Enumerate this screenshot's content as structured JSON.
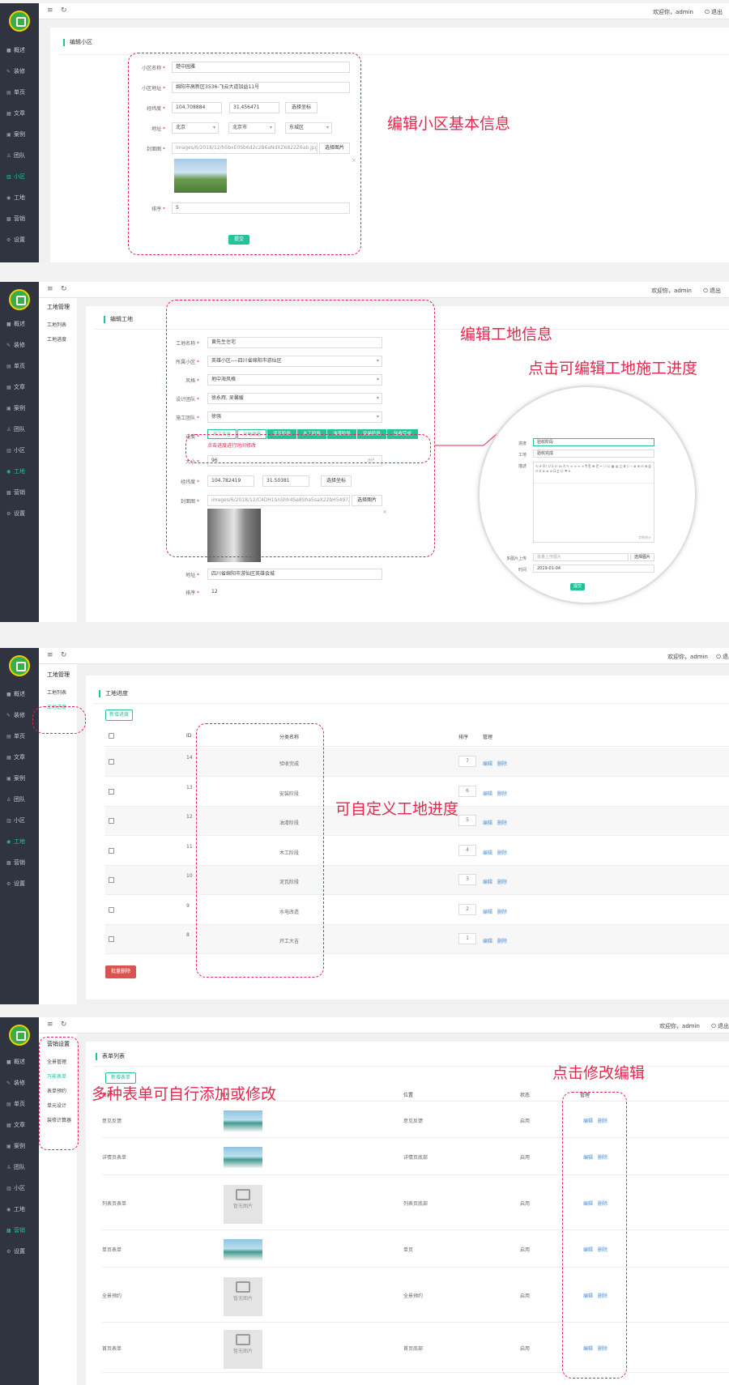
{
  "common": {
    "logo_text": "",
    "user_greeting": "欢迎你，admin",
    "logout_label": "退出",
    "menu_icon": "menu-icon",
    "refresh_icon": "refresh-icon",
    "nav": [
      {
        "label": "概述",
        "icon": "home-icon"
      },
      {
        "label": "装修",
        "icon": "brush-icon"
      },
      {
        "label": "单页",
        "icon": "page-icon"
      },
      {
        "label": "文章",
        "icon": "article-icon"
      },
      {
        "label": "案例",
        "icon": "case-icon"
      },
      {
        "label": "团队",
        "icon": "team-icon"
      },
      {
        "label": "小区",
        "icon": "building-icon"
      },
      {
        "label": "工地",
        "icon": "site-icon"
      },
      {
        "label": "营销",
        "icon": "marketing-icon"
      },
      {
        "label": "设置",
        "icon": "settings-icon"
      }
    ]
  },
  "panel1": {
    "nav_variant": [
      "概述",
      "装修",
      "单页",
      "文章",
      "案例",
      "团队",
      "小区",
      "工地",
      "营销",
      "设置"
    ],
    "title": "编辑小区",
    "fields": {
      "name_label": "小区名称",
      "name_value": "楚中园雅",
      "address_label": "小区地址",
      "address_value": "绵阳市高新区3536-飞云大道加益11号",
      "coord_label": "经纬度",
      "lng": "104.708884",
      "lat": "31.456471",
      "coord_btn": "选择坐标",
      "region_label": "地址",
      "province": "北京",
      "city": "北京市",
      "district": "东城区",
      "cover_label": "封面图",
      "cover_path": "images/6/2018/12/h5bxE0Sb6d2c2B6aNdXZ6822Z6ab.jpg",
      "cover_btn": "选择图片",
      "sort_label": "排序",
      "sort_value": "5",
      "submit": "提交"
    },
    "annotation": "编辑小区基本信息"
  },
  "panel2": {
    "subnav": [
      "工地管理",
      "工地列表",
      "工地进度"
    ],
    "title": "编辑工地",
    "fields": {
      "name_label": "工地名称",
      "name_value": "黄先生住宅",
      "community_label": "所属小区",
      "community_value": "英雄小区----四川省绵阳市游仙区",
      "style_label": "风格",
      "style_value": "地中海风格",
      "design_label": "设计团队",
      "design_value": "徐永辉, 吴馨媛",
      "build_label": "施工团队",
      "build_value": "徐强",
      "progress_label": "进度",
      "steps": [
        "开工大吉",
        "水电改造",
        "泥瓦阶段",
        "木工阶段",
        "油漆阶段",
        "安装阶段",
        "验收完成"
      ],
      "progress_hint": "点击进度进行时间修改",
      "size_label": "大小",
      "size_value": "96",
      "size_unit": "m²",
      "coord_label": "经纬度",
      "lng": "104.782419",
      "lat": "31.50381",
      "coord_btn": "选择坐标",
      "cover_label": "封面图",
      "cover_path": "images/6/2018/12/C4DH1SnShh4Sa8Sha5saX22bH54972.jpg",
      "cover_btn": "选择图片",
      "address_label": "地址",
      "address_value": "四川省绵阳市游仙区英雄会城",
      "sort_label": "排序",
      "sort_value": "12"
    },
    "annotation_top": "编辑工地信息",
    "annotation_progress": "点击可编辑工地施工进度",
    "zoom": {
      "stage_label": "进度",
      "stage_value": "验收阶段",
      "worksite_label": "工地",
      "worksite_value": "验收完成",
      "desc_label": "描述",
      "toolbar": "编辑器工具栏",
      "counter": "字数统计",
      "image_label": "多图片上传",
      "image_value": "批量上传图片",
      "image_btn": "选择图片",
      "time_label": "时间",
      "time_value": "2019-01-04",
      "submit": "提交"
    }
  },
  "panel3": {
    "subnav": [
      "工地管理",
      "工地列表",
      "工地进度"
    ],
    "title": "工地进度",
    "add_btn": "新增进度",
    "headers": {
      "id": "ID",
      "name": "分类名称",
      "sort": "排序",
      "manage": "管理"
    },
    "rows": [
      {
        "id": "14",
        "name": "验收完成",
        "sort": "7"
      },
      {
        "id": "13",
        "name": "安装阶段",
        "sort": "6"
      },
      {
        "id": "12",
        "name": "油漆阶段",
        "sort": "5"
      },
      {
        "id": "11",
        "name": "木工阶段",
        "sort": "4"
      },
      {
        "id": "10",
        "name": "泥瓦阶段",
        "sort": "3"
      },
      {
        "id": "9",
        "name": "水电改造",
        "sort": "2"
      },
      {
        "id": "8",
        "name": "开工大吉",
        "sort": "1"
      }
    ],
    "edit_label": "编辑",
    "delete_label": "删除",
    "batch_delete": "批量删除",
    "annotation": "可自定义工地进度"
  },
  "panel4": {
    "subnav": [
      "营销设置",
      "全景管理",
      "万能表单",
      "表单预约",
      "单元设计",
      "装修计算器"
    ],
    "title": "表单列表",
    "add_btn": "新增表单",
    "headers": {
      "name": "名称",
      "image": "图片",
      "position": "位置",
      "status": "状态",
      "manage": "管理"
    },
    "rows": [
      {
        "name": "意见反馈",
        "position": "意见反馈",
        "status": "启用",
        "img": "photo"
      },
      {
        "name": "详情页表单",
        "position": "详情页底部",
        "status": "启用",
        "img": "photo"
      },
      {
        "name": "列表页表单",
        "position": "列表页底部",
        "status": "启用",
        "img": "none"
      },
      {
        "name": "单页表单",
        "position": "单页",
        "status": "启用",
        "img": "photo"
      },
      {
        "name": "全景预约",
        "position": "全景预约",
        "status": "启用",
        "img": "none"
      },
      {
        "name": "首页表单",
        "position": "首页底部",
        "status": "启用",
        "img": "none"
      }
    ],
    "no_image": "暂无图片",
    "edit_label": "编辑",
    "delete_label": "删除",
    "annotation_left": "多种表单可自行添加或修改",
    "annotation_right": "点击修改编辑"
  }
}
